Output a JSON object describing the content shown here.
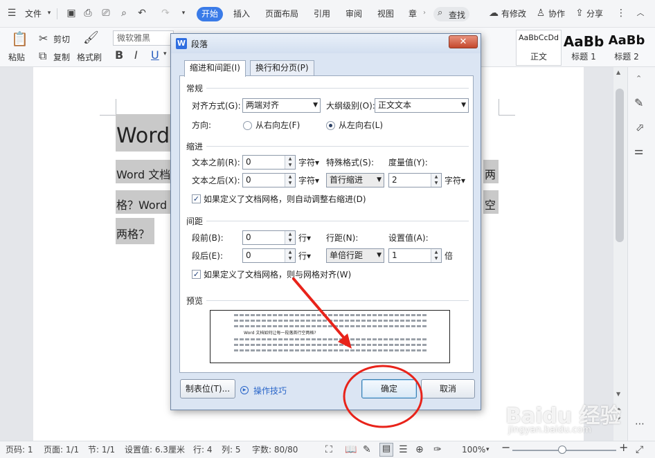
{
  "menubar": {
    "file_label": "文件",
    "tabs": [
      "开始",
      "插入",
      "页面布局",
      "引用",
      "审阅",
      "视图",
      "章"
    ],
    "search_label": "查找",
    "revise_label": "有修改",
    "collab_label": "协作",
    "share_label": "分享"
  },
  "ribbon": {
    "paste_label": "粘贴",
    "cut_label": "剪切",
    "copy_label": "复制",
    "format_painter_label": "格式刷",
    "font_name": "微软雅黑",
    "bold": "B",
    "italic": "I",
    "underline": "U",
    "styles": [
      {
        "sample": "AaBbCcDd",
        "name": "正文"
      },
      {
        "sample": "AaBb",
        "name": "标题 1"
      },
      {
        "sample": "AaBb",
        "name": "标题 2"
      }
    ]
  },
  "document": {
    "heading": "Word",
    "line1_left": "Word 文档",
    "line1_right": "两",
    "line2_left": "格？Word",
    "line2_right": "空",
    "line3": "两格？"
  },
  "dialog": {
    "title": "段落",
    "close": "✕",
    "tabs": [
      "缩进和间距(I)",
      "换行和分页(P)"
    ],
    "general": {
      "title": "常规",
      "align_label": "对齐方式(G):",
      "align_value": "两端对齐",
      "outline_label": "大纲级别(O):",
      "outline_value": "正文文本",
      "direction_label": "方向:",
      "rtl_label": "从右向左(F)",
      "ltr_label": "从左向右(L)"
    },
    "indent": {
      "title": "缩进",
      "before_label": "文本之前(R):",
      "before_value": "0",
      "before_unit": "字符▾",
      "after_label": "文本之后(X):",
      "after_value": "0",
      "after_unit": "字符▾",
      "special_label": "特殊格式(S):",
      "special_value": "首行缩进",
      "measure_label": "度量值(Y):",
      "measure_value": "2",
      "measure_unit": "字符▾",
      "grid_check": "如果定义了文档网格，则自动调整右缩进(D)"
    },
    "spacing": {
      "title": "间距",
      "before_label": "段前(B):",
      "before_value": "0",
      "before_unit": "行▾",
      "after_label": "段后(E):",
      "after_value": "0",
      "after_unit": "行▾",
      "line_label": "行距(N):",
      "line_value": "单倍行距",
      "set_label": "设置值(A):",
      "set_value": "1",
      "set_unit": "倍",
      "grid_check": "如果定义了文档网格，则与网格对齐(W)"
    },
    "preview": {
      "title": "预览",
      "sample_text": "Word 文档如何让每一段落首行空两格?"
    },
    "buttons": {
      "tabs": "制表位(T)...",
      "tips": "操作技巧",
      "ok": "确定",
      "cancel": "取消"
    }
  },
  "statusbar": {
    "page_num": "页码: 1",
    "page_count": "页面: 1/1",
    "section": "节: 1/1",
    "setting": "设置值: 6.3厘米",
    "row": "行: 4",
    "col": "列: 5",
    "words": "字数: 80/80",
    "zoom": "100%",
    "minus": "−",
    "plus": "+"
  },
  "watermark": {
    "brand": "Baidu 经验",
    "url": "jingyan.baidu.com"
  },
  "colors": {
    "accent": "#3a7be8",
    "annotation": "#e8231a"
  }
}
